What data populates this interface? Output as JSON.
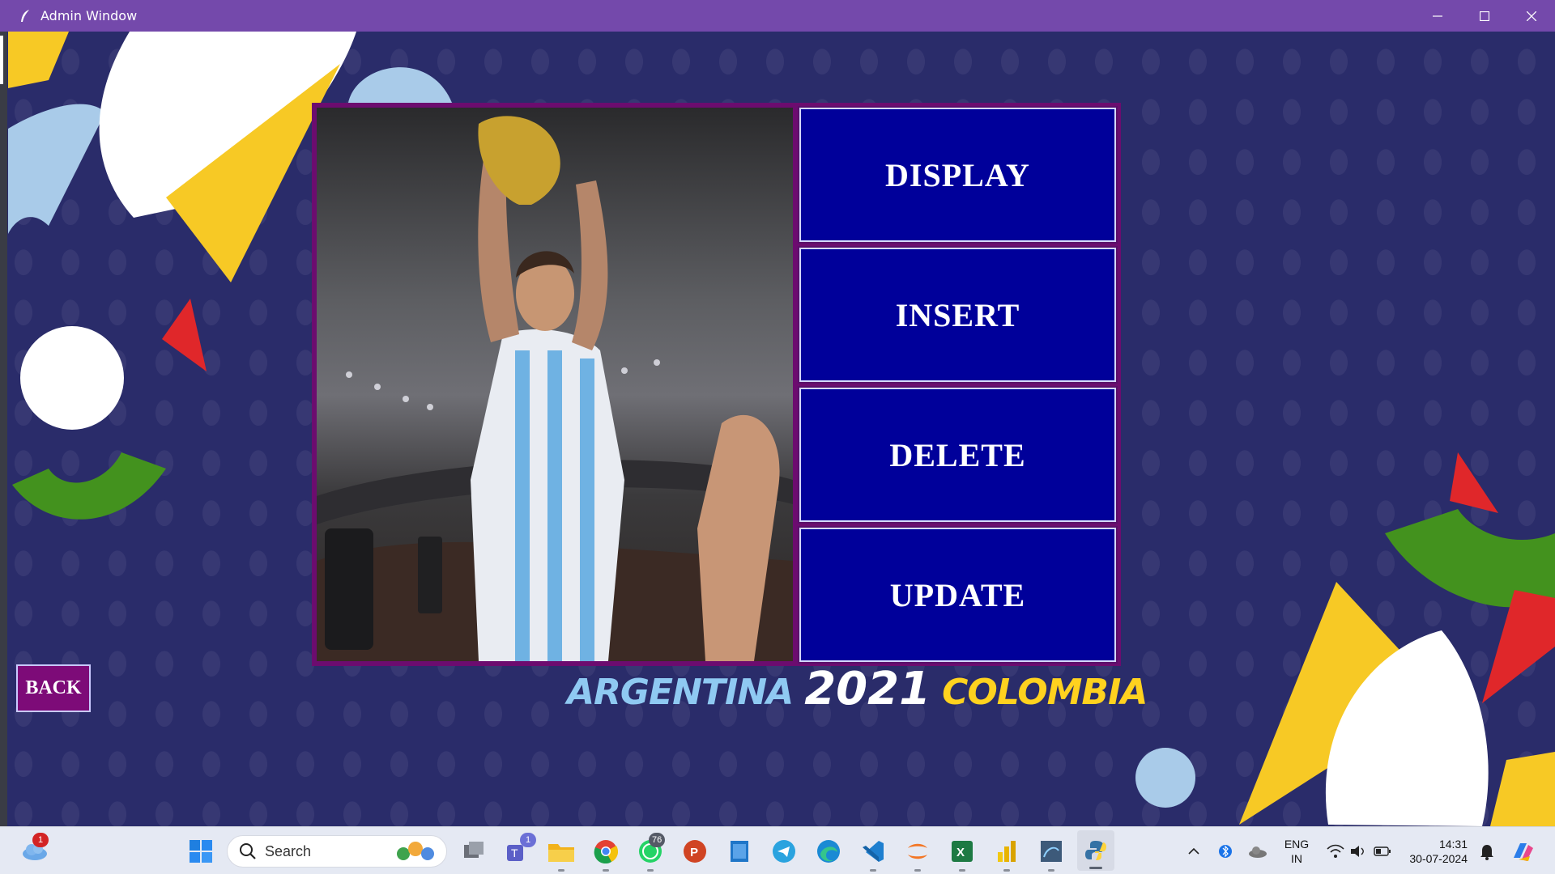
{
  "window": {
    "title": "Admin Window"
  },
  "menu": {
    "display_label": "DISPLAY",
    "insert_label": "INSERT",
    "delete_label": "DELETE",
    "update_label": "UPDATE",
    "back_label": "BACK"
  },
  "logo": {
    "left": "ARGENTINA",
    "year": "2021",
    "right": "COLOMBIA"
  },
  "taskbar": {
    "weather_badge": "1",
    "search_placeholder": "Search",
    "teams_badge": "1",
    "whatsapp_badge": "76",
    "pinned_icons": [
      "windows-start-icon",
      "task-view-icon",
      "teams-icon",
      "file-explorer-icon",
      "chrome-icon",
      "whatsapp-icon",
      "powerpoint-icon",
      "notepad-icon",
      "telegram-icon",
      "edge-icon",
      "vscode-icon",
      "jupyter-icon",
      "excel-icon",
      "power-bi-icon",
      "mysql-workbench-icon",
      "python-icon"
    ]
  },
  "tray": {
    "lang_line1": "ENG",
    "lang_line2": "IN",
    "time": "14:31",
    "date": "30-07-2024"
  },
  "colors": {
    "titlebar": "#7449ab",
    "button_fill": "#00009a",
    "panel_border": "#6c0c6f",
    "back_fill": "#7d0b78"
  }
}
